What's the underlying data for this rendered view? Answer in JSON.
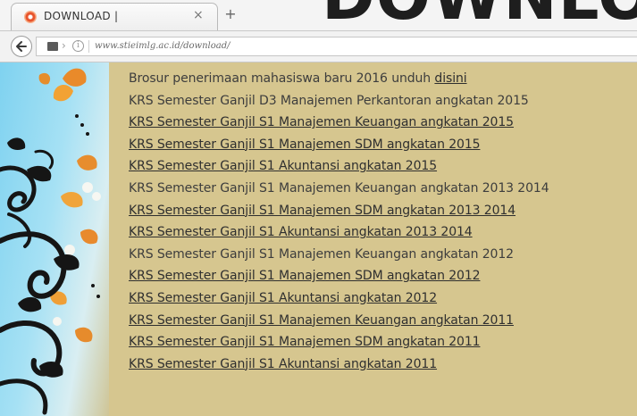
{
  "background_heading": "DOWNLOAD | Stieimlg",
  "browser": {
    "tab": {
      "title": "DOWNLOAD |",
      "close_icon": "close-icon",
      "favicon": "site-favicon"
    },
    "new_tab_label": "+",
    "nav": {
      "back_icon": "arrow-left-icon",
      "page_icon": "page-icon",
      "info_icon": "info-icon",
      "url": "www.stieimlg.ac.id/download/"
    }
  },
  "page": {
    "items": [
      {
        "text": "Brosur penerimaan mahasiswa baru 2016 unduh ",
        "link": "disini",
        "type": "mixed"
      },
      {
        "text": "KRS Semester Ganjil D3 Manajemen Perkantoran angkatan 2015",
        "type": "plain"
      },
      {
        "link": "KRS Semester Ganjil S1 Manajemen Keuangan angkatan 2015",
        "type": "link"
      },
      {
        "link": "KRS Semester Ganjil S1 Manajemen SDM angkatan 2015",
        "type": "link"
      },
      {
        "link": "KRS Semester Ganjil S1 Akuntansi angkatan 2015",
        "type": "link"
      },
      {
        "text": "KRS Semester Ganjil S1 Manajemen Keuangan angkatan 2013 2014",
        "type": "plain"
      },
      {
        "link": "KRS Semester Ganjil S1 Manajemen SDM angkatan 2013 2014",
        "type": "link"
      },
      {
        "link": "KRS Semester Ganjil S1 Akuntansi angkatan 2013 2014",
        "type": "link"
      },
      {
        "text": "KRS Semester Ganjil S1 Manajemen Keuangan angkatan 2012",
        "type": "plain"
      },
      {
        "link": "KRS Semester Ganjil S1 Manajemen SDM angkatan 2012",
        "type": "link"
      },
      {
        "link": "KRS Semester Ganjil S1 Akuntansi angkatan 2012",
        "type": "link"
      },
      {
        "link": "KRS Semester Ganjil S1 Manajemen Keuangan angkatan 2011",
        "type": "link"
      },
      {
        "link": "KRS Semester Ganjil S1 Manajemen SDM angkatan 2011",
        "type": "link"
      },
      {
        "link": "KRS Semester Ganjil S1 Akuntansi angkatan 2011",
        "type": "link"
      }
    ]
  },
  "colors": {
    "page_background": "#d6c68f",
    "left_panel_sky": "#8fd8f2",
    "link_text": "#2f2f2f",
    "tab_favicon": "#e8542c"
  }
}
